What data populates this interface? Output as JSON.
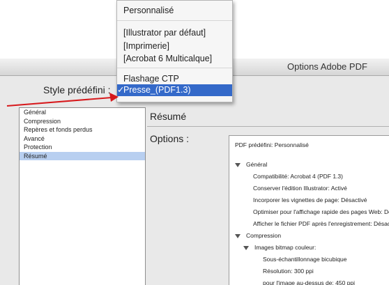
{
  "dialog": {
    "title": "Options Adobe PDF",
    "style_label": "Style prédéfini :"
  },
  "menu": {
    "items": [
      {
        "label": "Personnalisé",
        "selected": false,
        "checked": false
      },
      {
        "label": "[Illustrator par défaut]",
        "selected": false,
        "checked": false
      },
      {
        "label": "[Imprimerie]",
        "selected": false,
        "checked": false
      },
      {
        "label": "[Acrobat 6 Multicalque]",
        "selected": false,
        "checked": false
      },
      {
        "label": "Flashage CTP",
        "selected": false,
        "checked": false
      },
      {
        "label": "Presse_(PDF1.3)",
        "selected": true,
        "checked": true
      }
    ],
    "check_glyph": "✓"
  },
  "sidebar": {
    "items": [
      {
        "label": "Général",
        "selected": false
      },
      {
        "label": "Compression",
        "selected": false
      },
      {
        "label": "Repères et fonds perdus",
        "selected": false
      },
      {
        "label": "Avancé",
        "selected": false
      },
      {
        "label": "Protection",
        "selected": false
      },
      {
        "label": "Résumé",
        "selected": true
      }
    ]
  },
  "panel": {
    "title": "Résumé",
    "options_label": "Options :",
    "tree": [
      {
        "text": "PDF prédéfini: Personnalisé",
        "indent": 0,
        "triangle": false
      },
      {
        "text": "Général",
        "indent": 0,
        "triangle": true
      },
      {
        "text": "Compatibilité: Acrobat 4 (PDF 1.3)",
        "indent": 2,
        "triangle": false
      },
      {
        "text": "Conserver l'édition Illustrator: Activé",
        "indent": 2,
        "triangle": false
      },
      {
        "text": "Incorporer les vignettes de page: Désactivé",
        "indent": 2,
        "triangle": false
      },
      {
        "text": "Optimiser pour l'affichage rapide des pages Web: Désactivé",
        "indent": 2,
        "triangle": false
      },
      {
        "text": "Afficher le fichier PDF après l'enregistrement: Désactivé",
        "indent": 2,
        "triangle": false
      },
      {
        "text": "Compression",
        "indent": 0,
        "triangle": true
      },
      {
        "text": "Images bitmap couleur:",
        "indent": 1,
        "triangle": true
      },
      {
        "text": "Sous-échantillonnage bicubique",
        "indent": 3,
        "triangle": false
      },
      {
        "text": "Résolution: 300 ppi",
        "indent": 3,
        "triangle": false
      },
      {
        "text": "pour l'image au-dessus de: 450 ppi",
        "indent": 3,
        "triangle": false
      }
    ]
  },
  "colors": {
    "selection_blue": "#3469c9",
    "list_selection": "#b8cff0",
    "arrow_red": "#d7191c"
  }
}
